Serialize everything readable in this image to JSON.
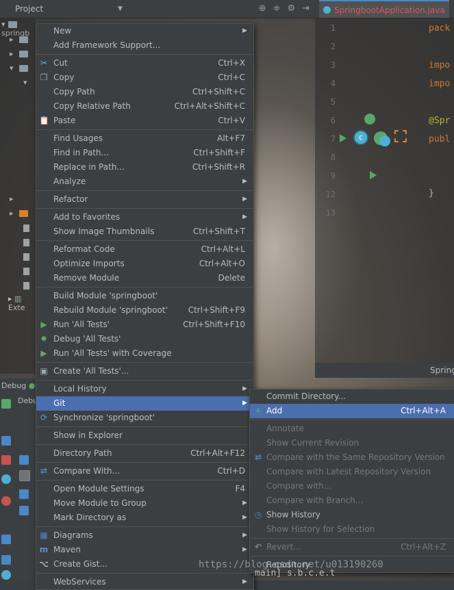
{
  "project_panel": {
    "title": "Project",
    "root_label": "springb",
    "external": "Exte"
  },
  "editor": {
    "tab_title": "SpringbootApplication.java",
    "line_numbers": [
      "1",
      "2",
      "3",
      "4",
      "5",
      "6",
      "7",
      "8",
      "9",
      "12",
      "13"
    ],
    "code_fragments": [
      "pack",
      "impo",
      "impo",
      "@Spr",
      "publ",
      "}"
    ],
    "footer_label": "Spring"
  },
  "debug": {
    "label": "Debug",
    "tab_label": "Debu"
  },
  "context_menu": {
    "items": [
      {
        "label": "New",
        "submenu": true
      },
      {
        "label": "Add Framework Support..."
      },
      {
        "sep": true
      },
      {
        "label": "Cut",
        "shortcut": "Ctrl+X",
        "icon": "cut-icon"
      },
      {
        "label": "Copy",
        "shortcut": "Ctrl+C",
        "icon": "copy-icon"
      },
      {
        "label": "Copy Path",
        "shortcut": "Ctrl+Shift+C"
      },
      {
        "label": "Copy Relative Path",
        "shortcut": "Ctrl+Alt+Shift+C"
      },
      {
        "label": "Paste",
        "shortcut": "Ctrl+V",
        "icon": "paste-icon"
      },
      {
        "sep": true
      },
      {
        "label": "Find Usages",
        "shortcut": "Alt+F7"
      },
      {
        "label": "Find in Path...",
        "shortcut": "Ctrl+Shift+F"
      },
      {
        "label": "Replace in Path...",
        "shortcut": "Ctrl+Shift+R"
      },
      {
        "label": "Analyze",
        "submenu": true
      },
      {
        "sep": true
      },
      {
        "label": "Refactor",
        "submenu": true
      },
      {
        "sep": true
      },
      {
        "label": "Add to Favorites",
        "submenu": true
      },
      {
        "label": "Show Image Thumbnails",
        "shortcut": "Ctrl+Shift+T"
      },
      {
        "sep": true
      },
      {
        "label": "Reformat Code",
        "shortcut": "Ctrl+Alt+L"
      },
      {
        "label": "Optimize Imports",
        "shortcut": "Ctrl+Alt+O"
      },
      {
        "label": "Remove Module",
        "shortcut": "Delete"
      },
      {
        "sep": true
      },
      {
        "label": "Build Module 'springboot'"
      },
      {
        "label": "Rebuild Module 'springboot'",
        "shortcut": "Ctrl+Shift+F9"
      },
      {
        "label": "Run 'All Tests'",
        "shortcut": "Ctrl+Shift+F10",
        "icon": "run-icon"
      },
      {
        "label": "Debug 'All Tests'",
        "icon": "debug-icon"
      },
      {
        "label": "Run 'All Tests' with Coverage",
        "icon": "coverage-icon"
      },
      {
        "sep": true
      },
      {
        "label": "Create 'All Tests'...",
        "icon": "create-test-icon"
      },
      {
        "sep": true
      },
      {
        "label": "Local History",
        "submenu": true
      },
      {
        "label": "Git",
        "submenu": true,
        "selected": true
      },
      {
        "label": "Synchronize 'springboot'",
        "icon": "sync-icon"
      },
      {
        "sep": true
      },
      {
        "label": "Show in Explorer"
      },
      {
        "sep": true
      },
      {
        "label": "Directory Path",
        "shortcut": "Ctrl+Alt+F12"
      },
      {
        "sep": true
      },
      {
        "label": "Compare With...",
        "shortcut": "Ctrl+D",
        "icon": "compare-icon"
      },
      {
        "sep": true
      },
      {
        "label": "Open Module Settings",
        "shortcut": "F4"
      },
      {
        "label": "Move Module to Group",
        "submenu": true
      },
      {
        "label": "Mark Directory as",
        "submenu": true
      },
      {
        "sep": true
      },
      {
        "label": "Diagrams",
        "submenu": true,
        "icon": "diagram-icon"
      },
      {
        "label": "Maven",
        "submenu": true,
        "icon": "maven-icon"
      },
      {
        "label": "Create Gist...",
        "icon": "gist-icon"
      },
      {
        "sep": true
      },
      {
        "label": "WebServices",
        "submenu": true
      }
    ]
  },
  "git_submenu": {
    "items": [
      {
        "label": "Commit Directory..."
      },
      {
        "label": "Add",
        "shortcut": "Ctrl+Alt+A",
        "selected": true,
        "icon": "plus-icon"
      },
      {
        "sep": true
      },
      {
        "label": "Annotate",
        "disabled": true
      },
      {
        "label": "Show Current Revision",
        "disabled": true
      },
      {
        "label": "Compare with the Same Repository Version",
        "disabled": true,
        "icon": "compare-icon"
      },
      {
        "label": "Compare with Latest Repository Version",
        "disabled": true
      },
      {
        "label": "Compare with...",
        "disabled": true
      },
      {
        "label": "Compare with Branch...",
        "disabled": true
      },
      {
        "label": "Show History",
        "icon": "history-icon"
      },
      {
        "label": "Show History for Selection",
        "disabled": true
      },
      {
        "sep": true
      },
      {
        "label": "Revert...",
        "shortcut": "Ctrl+Alt+Z",
        "disabled": true,
        "icon": "revert-icon"
      },
      {
        "sep": true
      },
      {
        "label": "Repository"
      }
    ]
  },
  "watermark": "https://blog.csdn.net/u013190260",
  "console_fragment": "main] s.b.c.e.t"
}
